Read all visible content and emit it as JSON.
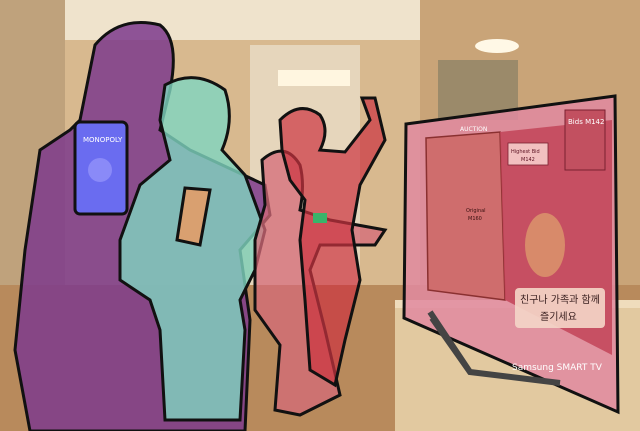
{
  "image": {
    "description_free": true
  },
  "tv": {
    "header_text": "AUCTION",
    "bids_label": "Bids M142",
    "highest_bid_label": "Highest Bid",
    "highest_bid_value": "M142",
    "original_label": "Original",
    "original_value": "M160",
    "banner_line1": "친구나 가족과 함께",
    "banner_line2": "즐기세요",
    "brand": "Samsung SMART TV"
  },
  "cards": {
    "monopoly_card_title": "MONOPOLY"
  },
  "colors": {
    "wall": "#d8b98f",
    "floor": "#b88a5c",
    "segment_purple": "#7c3a8c",
    "segment_teal": "#7fd6c0",
    "segment_pink": "#d46a78",
    "segment_red": "#cc3340",
    "segment_tv": "#e08aa0",
    "phone_blue": "#6a6cf0",
    "phone_tan": "#d9a070"
  }
}
